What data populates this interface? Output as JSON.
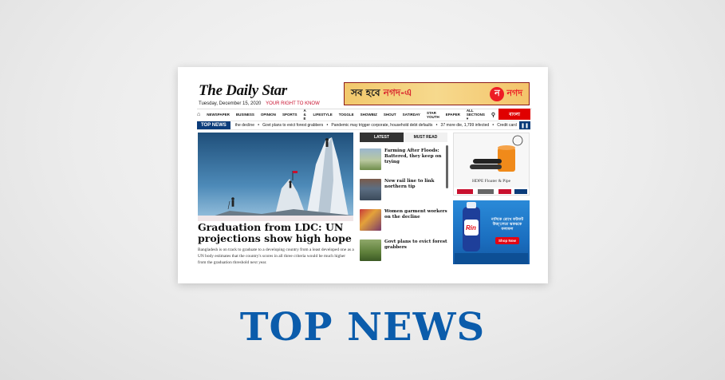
{
  "site": {
    "logo_text": "The Daily Star",
    "date": "Tuesday, December 15, 2020",
    "tagline": "YOUR RIGHT TO KNOW",
    "bangla_button": "বাংলা"
  },
  "top_ad": {
    "slogan_part1": "সব হবে ",
    "slogan_red": "নগদ-এ",
    "brand_name": "নগদ",
    "brand_initial": "ন"
  },
  "nav": {
    "items": [
      "NEWSPAPER",
      "BUSINESS",
      "OPINION",
      "SPORTS",
      "A & E",
      "LIFESTYLE",
      "TOGGLE",
      "SHOWBIZ",
      "SHOUT",
      "SATIRDAY",
      "STAR YOUTH",
      "EPAPER",
      "ALL SECTIONS ▾"
    ]
  },
  "ticker": {
    "label": "TOP NEWS",
    "items": [
      "the decline",
      "Govt plans to evict forest grabbers",
      "Pandemic may trigger corporate, household debt defaults",
      "37 more die, 1,799 infected",
      "Credit card"
    ]
  },
  "hero": {
    "title": "Graduation from LDC: UN projections show high hope",
    "summary": "Bangladesh is on track to graduate to a developing country from a least developed one as a UN body estimates that the country's scores in all three criteria would be much higher from the graduation threshold next year."
  },
  "latest_panel": {
    "tabs": [
      "LATEST",
      "MUST READ"
    ],
    "stories": [
      {
        "headline": "Farming After Floods: Battered, they keep on trying"
      },
      {
        "headline": "New rail line to link northern tip"
      },
      {
        "headline": "Women garment workers on the decline"
      },
      {
        "headline": "Govt plans to evict forest grabbers"
      }
    ]
  },
  "side_ads": {
    "ad1_caption": "HDPE Floater & Pipe",
    "ad2_text": "নাসিকে রোখে ফটাফট উজ্জ্বলতা ঝকঝকে ফলাফল",
    "ad2_button": "Shop Now",
    "ad2_brand": "Rin"
  },
  "page_title": "TOP NEWS",
  "colors": {
    "accent_blue": "#0b5cab",
    "brand_red": "#e00000",
    "ticker_blue": "#0b3c7a"
  }
}
